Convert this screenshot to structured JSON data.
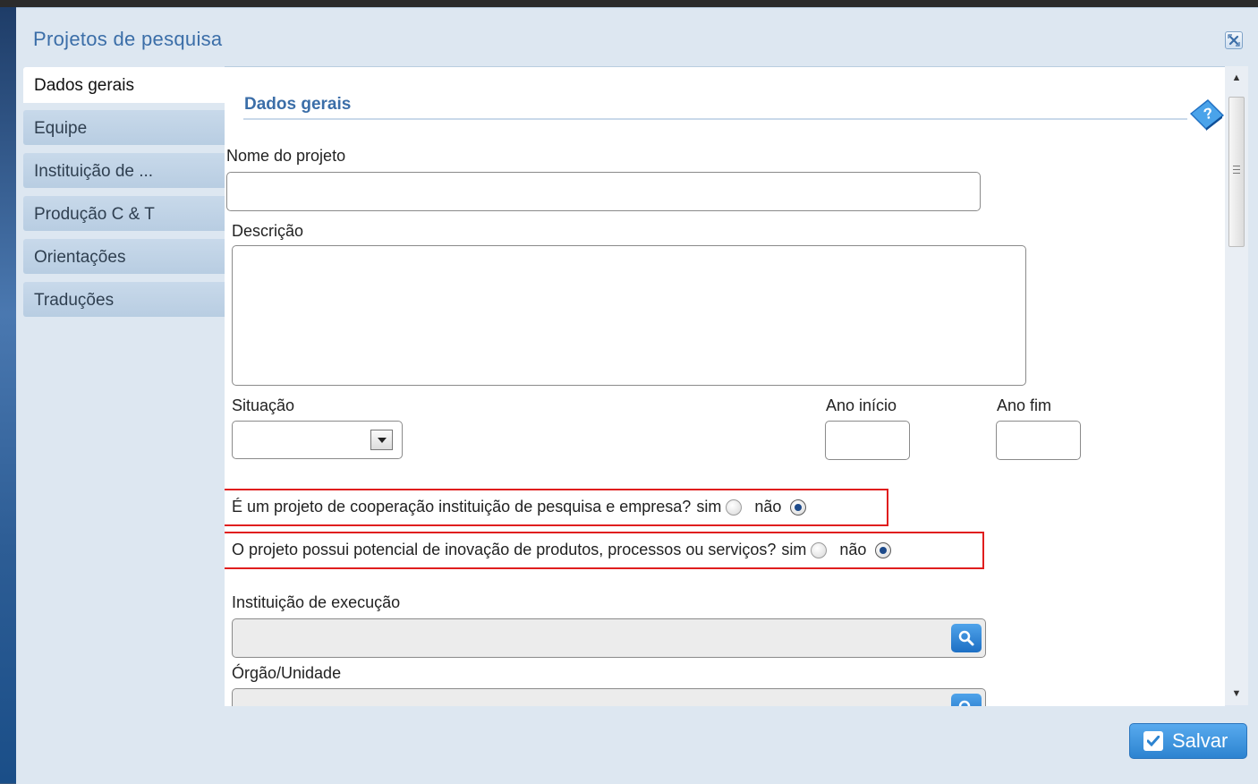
{
  "window": {
    "title": "Projetos de pesquisa"
  },
  "tabs": [
    {
      "label": "Dados gerais",
      "active": true
    },
    {
      "label": "Equipe",
      "active": false
    },
    {
      "label": "Instituição de ...",
      "active": false
    },
    {
      "label": "Produção C & T",
      "active": false
    },
    {
      "label": "Orientações",
      "active": false
    },
    {
      "label": "Traduções",
      "active": false
    }
  ],
  "form": {
    "section_title": "Dados gerais",
    "nome_label": "Nome do projeto",
    "nome_value": "",
    "descricao_label": "Descrição",
    "descricao_value": "",
    "situacao_label": "Situação",
    "situacao_value": "",
    "ano_inicio_label": "Ano início",
    "ano_inicio_value": "",
    "ano_fim_label": "Ano fim",
    "ano_fim_value": "",
    "q1_text": "É um projeto de cooperação instituição de pesquisa e empresa?",
    "q2_text": "O projeto possui potencial de inovação de produtos, processos ou serviços?",
    "sim_label": "sim",
    "nao_label": "não",
    "q1_selected": "não",
    "q2_selected": "não",
    "instituicao_label": "Instituição de execução",
    "instituicao_value": "",
    "orgao_label": "Órgão/Unidade",
    "orgao_value": ""
  },
  "footer": {
    "save_label": "Salvar"
  },
  "icons": {
    "close": "close-icon",
    "help": "help-book-icon",
    "search": "search-icon",
    "dropdown": "chevron-down-icon",
    "save": "check-icon"
  },
  "colors": {
    "title": "#3b6ea8",
    "highlight_border": "#e01e1e",
    "save_button": "#2c83d0"
  }
}
